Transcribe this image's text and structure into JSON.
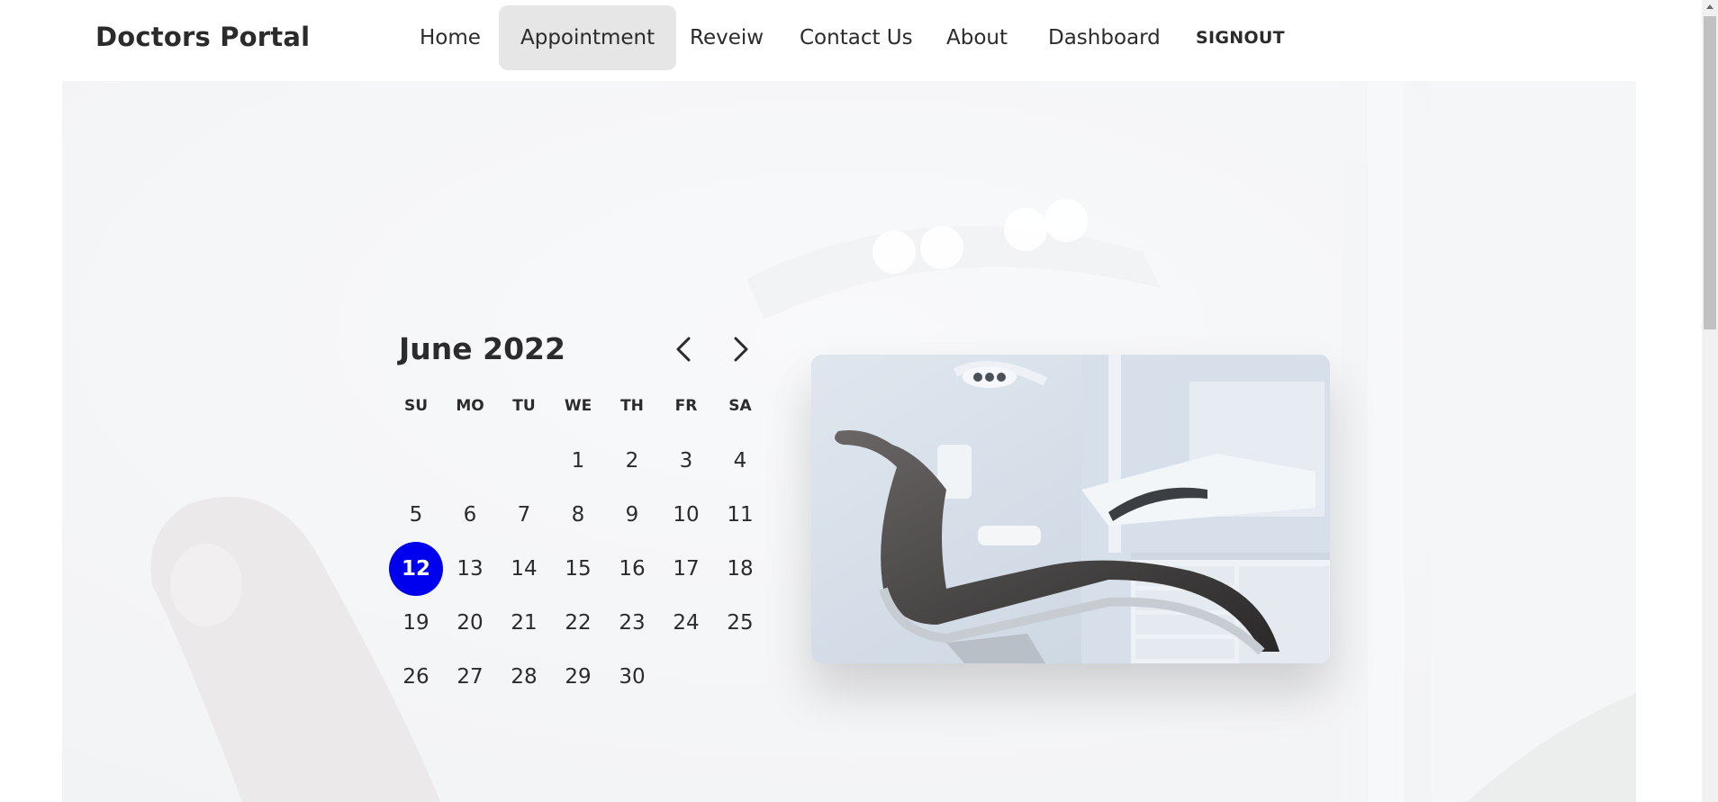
{
  "brand": "Doctors Portal",
  "nav": {
    "items": [
      {
        "label": "Home",
        "active": false
      },
      {
        "label": "Appointment",
        "active": true
      },
      {
        "label": "Reveiw",
        "active": false
      },
      {
        "label": "Contact Us",
        "active": false
      },
      {
        "label": "About",
        "active": false
      },
      {
        "label": "Dashboard",
        "active": false
      },
      {
        "label": "SIGNOUT",
        "active": false
      }
    ]
  },
  "calendar": {
    "month_label": "June 2022",
    "weekdays": [
      "SU",
      "MO",
      "TU",
      "WE",
      "TH",
      "FR",
      "SA"
    ],
    "leading_blank_days": 3,
    "days": [
      1,
      2,
      3,
      4,
      5,
      6,
      7,
      8,
      9,
      10,
      11,
      12,
      13,
      14,
      15,
      16,
      17,
      18,
      19,
      20,
      21,
      22,
      23,
      24,
      25,
      26,
      27,
      28,
      29,
      30
    ],
    "selected_day": 12,
    "prev_icon": "chevron-left-icon",
    "next_icon": "chevron-right-icon",
    "selected_color": "#0000ee"
  },
  "photo": {
    "subject": "dental-chair-photo"
  },
  "colors": {
    "active_nav_bg": "#e6e6e6",
    "text": "#2b2b2b"
  }
}
